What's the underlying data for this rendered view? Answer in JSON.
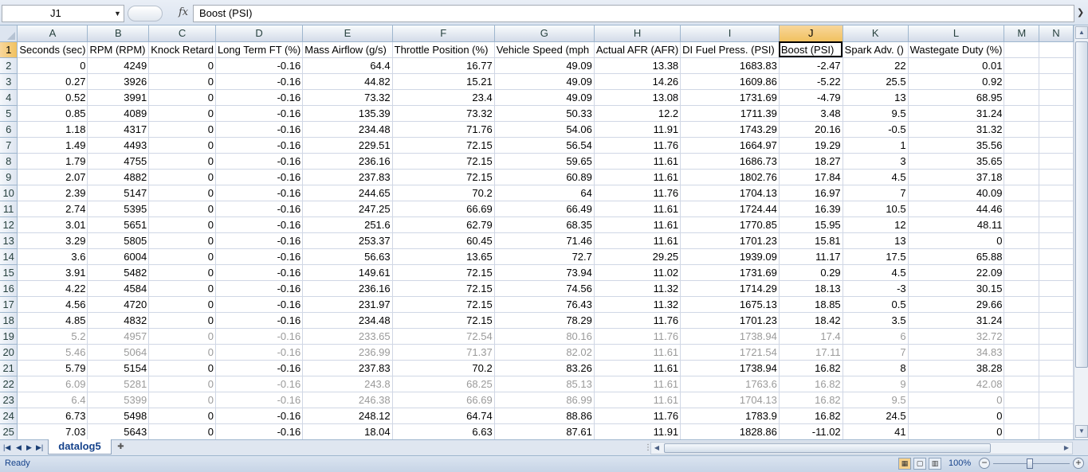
{
  "formula_bar": {
    "name_box": "J1",
    "fx_symbol": "fx",
    "content": "Boost (PSI)"
  },
  "grid": {
    "columns": [
      "A",
      "B",
      "C",
      "D",
      "E",
      "F",
      "G",
      "H",
      "I",
      "J",
      "K",
      "L",
      "M",
      "N"
    ],
    "active_column": "J",
    "active_row": 1,
    "headers": [
      "Seconds (sec)",
      "RPM (RPM)",
      "Knock Retard",
      "Long Term FT (%)",
      "Mass Airflow (g/s)",
      "Throttle Position (%)",
      "Vehicle Speed (mph",
      "Actual AFR (AFR)",
      "DI Fuel Press. (PSI)",
      "Boost (PSI)",
      "Spark Adv. ()",
      "Wastegate Duty (%)",
      "",
      ""
    ],
    "rows": [
      [
        "0",
        "4249",
        "0",
        "-0.16",
        "64.4",
        "16.77",
        "49.09",
        "13.38",
        "1683.83",
        "-2.47",
        "22",
        "0.01"
      ],
      [
        "0.27",
        "3926",
        "0",
        "-0.16",
        "44.82",
        "15.21",
        "49.09",
        "14.26",
        "1609.86",
        "-5.22",
        "25.5",
        "0.92"
      ],
      [
        "0.52",
        "3991",
        "0",
        "-0.16",
        "73.32",
        "23.4",
        "49.09",
        "13.08",
        "1731.69",
        "-4.79",
        "13",
        "68.95"
      ],
      [
        "0.85",
        "4089",
        "0",
        "-0.16",
        "135.39",
        "73.32",
        "50.33",
        "12.2",
        "1711.39",
        "3.48",
        "9.5",
        "31.24"
      ],
      [
        "1.18",
        "4317",
        "0",
        "-0.16",
        "234.48",
        "71.76",
        "54.06",
        "11.91",
        "1743.29",
        "20.16",
        "-0.5",
        "31.32"
      ],
      [
        "1.49",
        "4493",
        "0",
        "-0.16",
        "229.51",
        "72.15",
        "56.54",
        "11.76",
        "1664.97",
        "19.29",
        "1",
        "35.56"
      ],
      [
        "1.79",
        "4755",
        "0",
        "-0.16",
        "236.16",
        "72.15",
        "59.65",
        "11.61",
        "1686.73",
        "18.27",
        "3",
        "35.65"
      ],
      [
        "2.07",
        "4882",
        "0",
        "-0.16",
        "237.83",
        "72.15",
        "60.89",
        "11.61",
        "1802.76",
        "17.84",
        "4.5",
        "37.18"
      ],
      [
        "2.39",
        "5147",
        "0",
        "-0.16",
        "244.65",
        "70.2",
        "64",
        "11.76",
        "1704.13",
        "16.97",
        "7",
        "40.09"
      ],
      [
        "2.74",
        "5395",
        "0",
        "-0.16",
        "247.25",
        "66.69",
        "66.49",
        "11.61",
        "1724.44",
        "16.39",
        "10.5",
        "44.46"
      ],
      [
        "3.01",
        "5651",
        "0",
        "-0.16",
        "251.6",
        "62.79",
        "68.35",
        "11.61",
        "1770.85",
        "15.95",
        "12",
        "48.11"
      ],
      [
        "3.29",
        "5805",
        "0",
        "-0.16",
        "253.37",
        "60.45",
        "71.46",
        "11.61",
        "1701.23",
        "15.81",
        "13",
        "0"
      ],
      [
        "3.6",
        "6004",
        "0",
        "-0.16",
        "56.63",
        "13.65",
        "72.7",
        "29.25",
        "1939.09",
        "11.17",
        "17.5",
        "65.88"
      ],
      [
        "3.91",
        "5482",
        "0",
        "-0.16",
        "149.61",
        "72.15",
        "73.94",
        "11.02",
        "1731.69",
        "0.29",
        "4.5",
        "22.09"
      ],
      [
        "4.22",
        "4584",
        "0",
        "-0.16",
        "236.16",
        "72.15",
        "74.56",
        "11.32",
        "1714.29",
        "18.13",
        "-3",
        "30.15"
      ],
      [
        "4.56",
        "4720",
        "0",
        "-0.16",
        "231.97",
        "72.15",
        "76.43",
        "11.32",
        "1675.13",
        "18.85",
        "0.5",
        "29.66"
      ],
      [
        "4.85",
        "4832",
        "0",
        "-0.16",
        "234.48",
        "72.15",
        "78.29",
        "11.76",
        "1701.23",
        "18.42",
        "3.5",
        "31.24"
      ],
      [
        "5.2",
        "4957",
        "0",
        "-0.16",
        "233.65",
        "72.54",
        "80.16",
        "11.76",
        "1738.94",
        "17.4",
        "6",
        "32.72"
      ],
      [
        "5.46",
        "5064",
        "0",
        "-0.16",
        "236.99",
        "71.37",
        "82.02",
        "11.61",
        "1721.54",
        "17.11",
        "7",
        "34.83"
      ],
      [
        "5.79",
        "5154",
        "0",
        "-0.16",
        "237.83",
        "70.2",
        "83.26",
        "11.61",
        "1738.94",
        "16.82",
        "8",
        "38.28"
      ],
      [
        "6.09",
        "5281",
        "0",
        "-0.16",
        "243.8",
        "68.25",
        "85.13",
        "11.61",
        "1763.6",
        "16.82",
        "9",
        "42.08"
      ],
      [
        "6.4",
        "5399",
        "0",
        "-0.16",
        "246.38",
        "66.69",
        "86.99",
        "11.61",
        "1704.13",
        "16.82",
        "9.5",
        "0"
      ],
      [
        "6.73",
        "5498",
        "0",
        "-0.16",
        "248.12",
        "64.74",
        "88.86",
        "11.76",
        "1783.9",
        "16.82",
        "24.5",
        "0"
      ],
      [
        "7.03",
        "5643",
        "0",
        "-0.16",
        "18.04",
        "6.63",
        "87.61",
        "11.91",
        "1828.86",
        "-11.02",
        "41",
        "0"
      ]
    ]
  },
  "sheet_tabs": {
    "active": "datalog5"
  },
  "status_bar": {
    "status": "Ready",
    "zoom": "100%",
    "zoom_minus": "−",
    "zoom_plus": "+"
  },
  "colors": {
    "header_bg": "#dde5f0",
    "active_header": "#f1c15f",
    "gridline": "#d0d7e5",
    "tab_text": "#15428b"
  },
  "icons": {
    "fx": "function-icon",
    "dropdown": "chevron-down-icon",
    "new_sheet": "insert-worksheet-icon"
  }
}
